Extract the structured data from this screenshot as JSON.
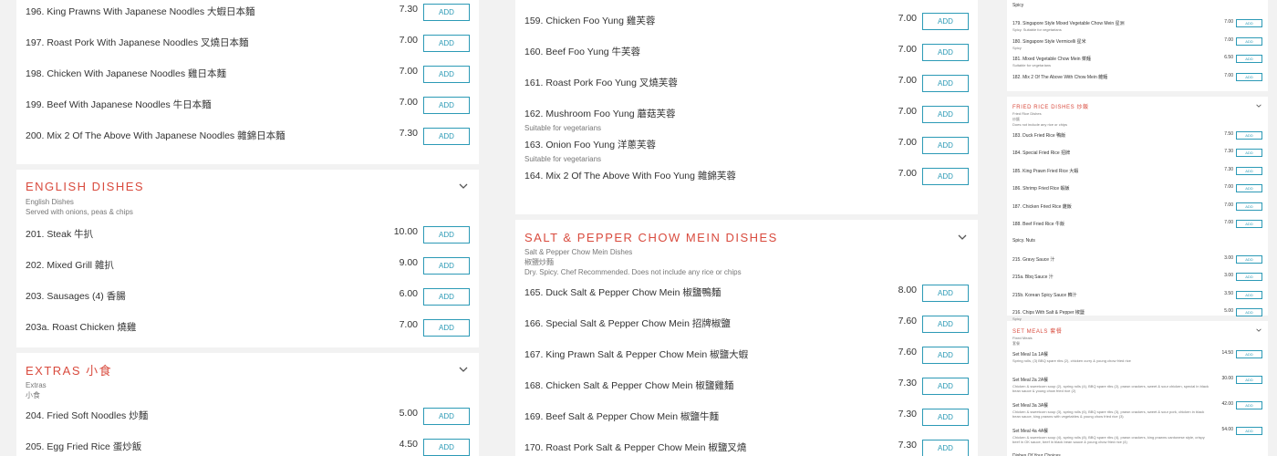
{
  "col1": {
    "top_items": [
      {
        "name": "196. King Prawns With Japanese Noodles 大蝦日本麵",
        "price": "7.30",
        "add": "ADD"
      },
      {
        "name": "197. Roast Pork With Japanese Noodles 叉燒日本麵",
        "price": "7.00",
        "add": "ADD"
      },
      {
        "name": "198. Chicken With Japanese Noodles 雞日本麵",
        "price": "7.00",
        "add": "ADD"
      },
      {
        "name": "199. Beef With Japanese Noodles 牛日本麵",
        "price": "7.00",
        "add": "ADD"
      },
      {
        "name": "200. Mix 2 Of The Above With Japanese Noodles 雜錦日本麵",
        "price": "7.30",
        "add": "ADD"
      }
    ],
    "english": {
      "title": "ENGLISH DISHES",
      "desc1": "English Dishes",
      "desc2": "Served with onions, peas & chips",
      "items": [
        {
          "name": "201. Steak 牛扒",
          "price": "10.00",
          "add": "ADD"
        },
        {
          "name": "202. Mixed Grill 雜扒",
          "price": "9.00",
          "add": "ADD"
        },
        {
          "name": "203. Sausages (4) 香腸",
          "price": "6.00",
          "add": "ADD"
        },
        {
          "name": "203a. Roast Chicken 燒雞",
          "price": "7.00",
          "add": "ADD"
        }
      ]
    },
    "extras": {
      "title": "EXTRAS 小食",
      "desc1": "Extras",
      "desc2": "小食",
      "items": [
        {
          "name": "204. Fried Soft Noodles 炒麵",
          "price": "5.00",
          "add": "ADD"
        },
        {
          "name": "205. Egg Fried Rice 蛋炒飯",
          "price": "4.50",
          "add": "ADD"
        }
      ]
    }
  },
  "col2": {
    "top_items": [
      {
        "name": "159. Chicken Foo Yung 雞芙蓉",
        "sub": "",
        "price": "7.00",
        "add": "ADD"
      },
      {
        "name": "160. Beef Foo Yung 牛芙蓉",
        "sub": "",
        "price": "7.00",
        "add": "ADD"
      },
      {
        "name": "161. Roast Pork Foo Yung 叉燒芙蓉",
        "sub": "",
        "price": "7.00",
        "add": "ADD"
      },
      {
        "name": "162. Mushroom Foo Yung 蘑菇芙蓉",
        "sub": "Suitable for vegetarians",
        "price": "7.00",
        "add": "ADD"
      },
      {
        "name": "163. Onion Foo Yung 洋蔥芙蓉",
        "sub": "Suitable for vegetarians",
        "price": "7.00",
        "add": "ADD"
      },
      {
        "name": "164. Mix 2 Of The Above With Foo Yung 雜錦芙蓉",
        "sub": "",
        "price": "7.00",
        "add": "ADD"
      }
    ],
    "salt": {
      "title": "SALT & PEPPER CHOW MEIN DISHES",
      "desc1": "Salt & Pepper Chow Mein Dishes",
      "desc2": "椒鹽炒麵",
      "desc3": "Dry. Spicy. Chef Recommended. Does not include any rice or chips",
      "items": [
        {
          "name": "165. Duck Salt & Pepper Chow Mein 椒鹽鴨麵",
          "price": "8.00",
          "add": "ADD"
        },
        {
          "name": "166. Special Salt & Pepper Chow Mein 招牌椒鹽",
          "price": "7.60",
          "add": "ADD"
        },
        {
          "name": "167. King Prawn Salt & Pepper Chow Mein 椒鹽大蝦",
          "price": "7.60",
          "add": "ADD"
        },
        {
          "name": "168. Chicken Salt & Pepper Chow Mein 椒鹽雞麵",
          "price": "7.30",
          "add": "ADD"
        },
        {
          "name": "169. Beef Salt & Pepper Chow Mein 椒鹽牛麵",
          "price": "7.30",
          "add": "ADD"
        },
        {
          "name": "170. Roast Pork Salt & Pepper Chow Mein 椒鹽叉燒",
          "price": "7.30",
          "add": "ADD"
        }
      ]
    }
  },
  "col3": {
    "top_items": [
      {
        "name": "Spicy",
        "sub": "",
        "price": "",
        "add": ""
      },
      {
        "name": "179. Singapore Style Mixed Vegetable Chow Mein 星洲",
        "sub": "Spicy. Suitable for vegetarians",
        "price": "7.00",
        "add": "ADD"
      },
      {
        "name": "180. Singapore Style Vermicelli 星米",
        "sub": "Spicy",
        "price": "7.00",
        "add": "ADD"
      },
      {
        "name": "181. Mixed Vegetable Chow Mein 菜麵",
        "sub": "Suitable for vegetarians",
        "price": "6.50",
        "add": "ADD"
      },
      {
        "name": "182. Mix 2 Of The Above With Chow Mein 雜麵",
        "sub": "",
        "price": "7.00",
        "add": "ADD"
      }
    ],
    "fried": {
      "title": "FRIED RICE DISHES 炒飯",
      "desc1": "Fried Rice Dishes",
      "desc2": "炒飯",
      "desc3": "Does not include any rice or chips",
      "items": [
        {
          "name": "183. Duck Fried Rice 鴨飯",
          "sub": "",
          "price": "7.50",
          "add": "ADD"
        },
        {
          "name": "184. Special Fried Rice 招牌",
          "sub": "",
          "price": "7.30",
          "add": "ADD"
        },
        {
          "name": "185. King Prawn Fried Rice 大蝦",
          "sub": "",
          "price": "7.30",
          "add": "ADD"
        },
        {
          "name": "186. Shrimp Fried Rice 蝦飯",
          "sub": "",
          "price": "7.00",
          "add": "ADD"
        },
        {
          "name": "187. Chicken Fried Rice 雞飯",
          "sub": "",
          "price": "7.00",
          "add": "ADD"
        },
        {
          "name": "188. Beef Fried Rice 牛飯",
          "sub": "",
          "price": "7.00",
          "add": "ADD"
        },
        {
          "name": "Spicy. Nuts",
          "sub": "",
          "price": "",
          "add": ""
        },
        {
          "name": "215. Gravy Sauce 汁",
          "sub": "",
          "price": "3.00",
          "add": "ADD"
        },
        {
          "name": "215a. Bbq Sauce 汁",
          "sub": "",
          "price": "3.00",
          "add": "ADD"
        },
        {
          "name": "215b. Korean Spicy Sauce 韓汁",
          "sub": "",
          "price": "3.50",
          "add": "ADD"
        },
        {
          "name": "216. Chips With Salt & Pepper 椒鹽",
          "sub": "Spicy",
          "price": "5.00",
          "add": "ADD"
        }
      ]
    },
    "set": {
      "title": "SET MEALS 套餐",
      "desc1": "Fixed Meals",
      "desc2": "套餐",
      "items": [
        {
          "name": "Set Meal 1a 1A餐",
          "sub": "Spring rolls, (3) BBQ spare ribs (2), chicken curry & young chow fried rice",
          "price": "14.50",
          "add": "ADD"
        },
        {
          "name": "Set Meal 2a 2A餐",
          "sub": "Chicken & sweetcorn soup (2), spring rolls (4), BBQ spare ribs (2), prawn crackers, sweet & sour chicken, special in black bean sauce & young chow fried rice (2)",
          "price": "30.00",
          "add": "ADD"
        },
        {
          "name": "Set Meal 3a 3A餐",
          "sub": "Chicken & sweetcorn soup (3), spring rolls (6), BBQ spare ribs (3), prawn crackers, sweet & sour pork, chicken in black bean sauce, king prawns with vegetables & young chow fried rice (3)",
          "price": "42.00",
          "add": "ADD"
        },
        {
          "name": "Set Meal 4a 4A餐",
          "sub": "Chicken & sweetcorn soup (4), spring rolls (8), BBQ spare ribs (4), prawn crackers, king prawns cantonese style, crispy beef in OK sauce, beef in black bean sauce & young chow fried rice (4)",
          "price": "54.00",
          "add": "ADD"
        },
        {
          "name": "Dishes Of Your Choices",
          "sub": "",
          "price": "",
          "add": ""
        }
      ]
    }
  },
  "colors": {
    "accent": "#d94b3e",
    "button": "#2c9ab6",
    "background": "#f2f2f2"
  },
  "icons": {
    "section_toggle": "chevron-down-icon"
  }
}
